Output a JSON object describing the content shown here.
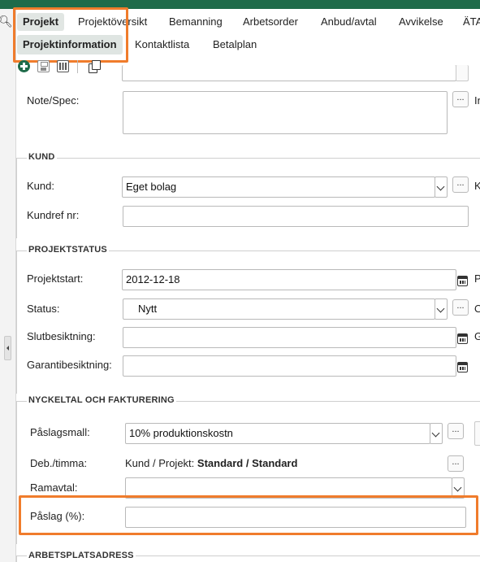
{
  "tabs_main": [
    "Projekt",
    "Projektöversikt",
    "Bemanning",
    "Arbetsorder",
    "Anbud/avtal",
    "Avvikelse",
    "ÄTA"
  ],
  "tabs_sub": [
    "Projektinformation",
    "Kontaktlista",
    "Betalplan"
  ],
  "ellipsis": "...",
  "top_form": {
    "note_label": "Note/Spec:",
    "right_label_cut": "In"
  },
  "kund": {
    "title": "KUND",
    "kund_label": "Kund:",
    "kund_value": "Eget bolag",
    "kundref_label": "Kundref nr:",
    "kundref_value": "",
    "right_label_cut": "K"
  },
  "projektstatus": {
    "title": "PROJEKTSTATUS",
    "projektstart_label": "Projektstart:",
    "projektstart_value": "2012-12-18",
    "status_label": "Status:",
    "status_value": "Nytt",
    "slutbesiktning_label": "Slutbesiktning:",
    "slutbesiktning_value": "",
    "garantibesiktning_label": "Garantibesiktning:",
    "garantibesiktning_value": "",
    "right_cut_1": "P",
    "right_cut_2": "O",
    "right_cut_3": "G"
  },
  "nyckeltal": {
    "title": "NYCKELTAL OCH FAKTURERING",
    "paslagsmall_label": "Påslagsmall:",
    "paslagsmall_value": "10% produktionskostn",
    "deb_label": "Deb./timma:",
    "deb_prefix": "Kund / Projekt:",
    "deb_value": "Standard / Standard",
    "ramavtal_label": "Ramavtal:",
    "ramavtal_value": "",
    "paslag_label": "Påslag (%):",
    "paslag_value": ""
  },
  "arbetsplatsadress": {
    "title": "ARBETSPLATSADRESS"
  }
}
